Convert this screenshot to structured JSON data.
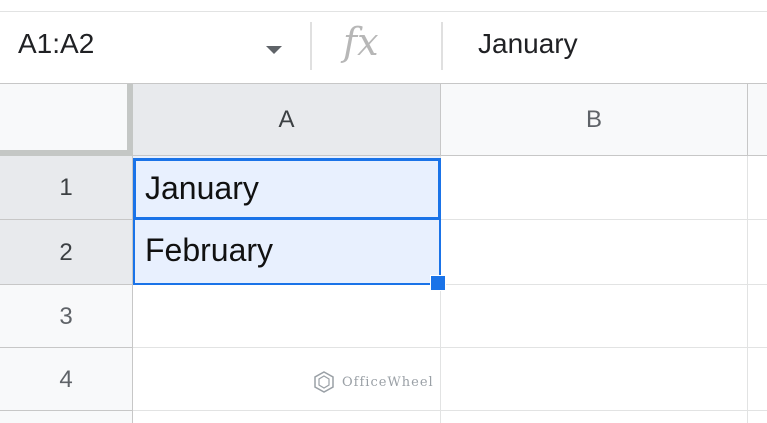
{
  "formula_bar": {
    "name_box": "A1:A2",
    "fx_label": "fx",
    "value": "January"
  },
  "columns": [
    "A",
    "B"
  ],
  "rows": [
    {
      "number": "1",
      "a": "January",
      "b": ""
    },
    {
      "number": "2",
      "a": "February",
      "b": ""
    },
    {
      "number": "3",
      "a": "",
      "b": ""
    },
    {
      "number": "4",
      "a": "",
      "b": ""
    }
  ],
  "watermark": {
    "text": "OfficeWheel"
  },
  "colors": {
    "selection": "#1a73e8",
    "selection_fill": "#e8f0fe"
  }
}
